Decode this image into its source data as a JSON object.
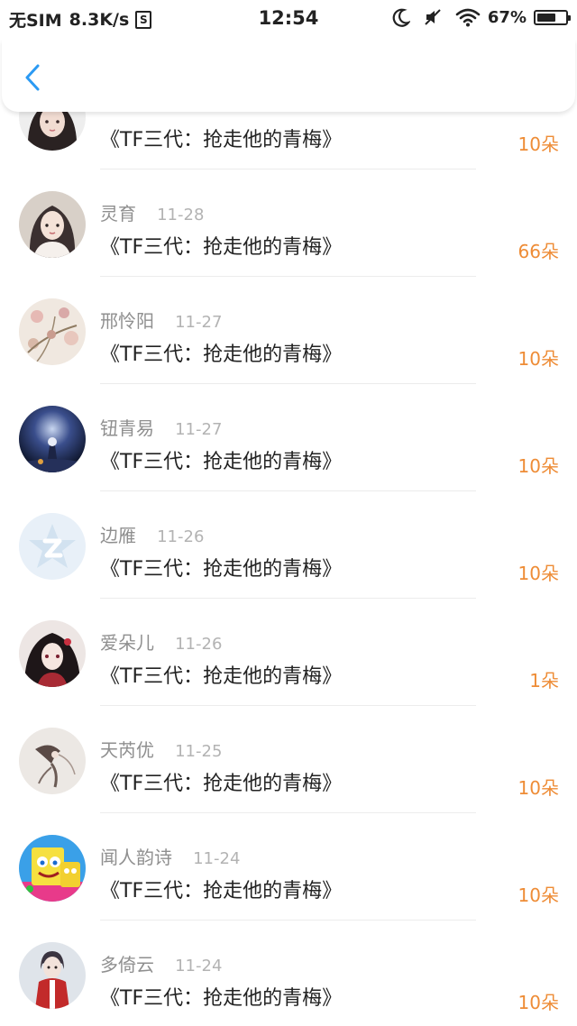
{
  "status_bar": {
    "carrier": "无SIM",
    "net_speed": "8.3K/s",
    "s_badge": "S",
    "time": "12:54",
    "battery": "67%",
    "battery_level": 0.67,
    "icons": [
      "moon-icon",
      "silent-icon",
      "wifi-icon",
      "battery-icon"
    ]
  },
  "header": {
    "back_icon": "chevron-left-icon",
    "accent_color": "#2b9af3"
  },
  "colors": {
    "amount": "#ee8c36",
    "name": "#8f8f8f",
    "date": "#b3b3b3",
    "title": "#222222"
  },
  "gifts": [
    {
      "name": "",
      "date": "",
      "title": "《TF三代：抢走他的青梅》",
      "amount": "10朵",
      "avatar": "girl-dark-hair-avatar"
    },
    {
      "name": "灵育",
      "date": "11-28",
      "title": "《TF三代：抢走他的青梅》",
      "amount": "66朵",
      "avatar": "girl-portrait-avatar"
    },
    {
      "name": "邢怜阳",
      "date": "11-27",
      "title": "《TF三代：抢走他的青梅》",
      "amount": "10朵",
      "avatar": "floral-painting-avatar"
    },
    {
      "name": "钮青易",
      "date": "11-27",
      "title": "《TF三代：抢走他的青梅》",
      "amount": "10朵",
      "avatar": "night-scene-avatar"
    },
    {
      "name": "边雁",
      "date": "11-26",
      "title": "《TF三代：抢走他的青梅》",
      "amount": "10朵",
      "avatar": "default-star-avatar"
    },
    {
      "name": "爱朵儿",
      "date": "11-26",
      "title": "《TF三代：抢走他的青梅》",
      "amount": "1朵",
      "avatar": "anime-girl-avatar"
    },
    {
      "name": "天芮优",
      "date": "11-25",
      "title": "《TF三代：抢走他的青梅》",
      "amount": "10朵",
      "avatar": "ink-sketch-avatar"
    },
    {
      "name": "闻人韵诗",
      "date": "11-24",
      "title": "《TF三代：抢走他的青梅》",
      "amount": "10朵",
      "avatar": "cartoon-sponge-avatar"
    },
    {
      "name": "多倚云",
      "date": "11-24",
      "title": "《TF三代：抢走他的青梅》",
      "amount": "10朵",
      "avatar": "anime-boy-red-avatar"
    }
  ]
}
